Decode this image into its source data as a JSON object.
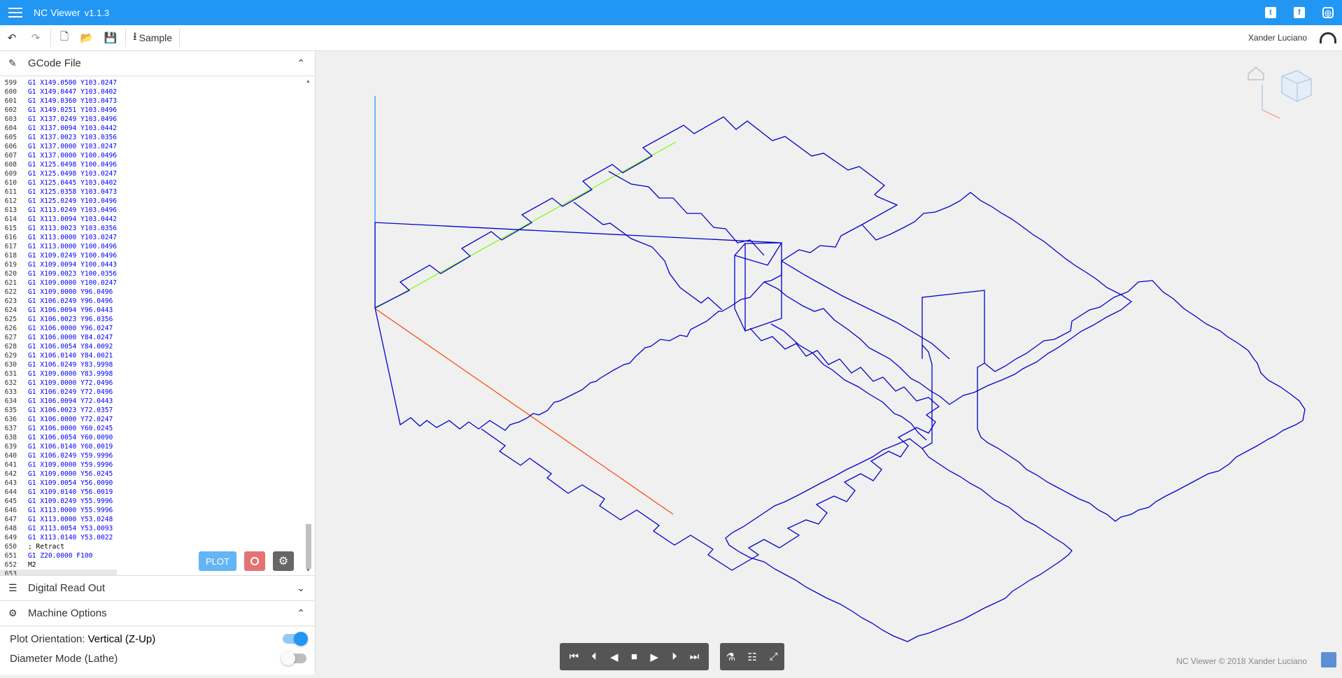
{
  "app": {
    "title": "NC Viewer",
    "version": "v1.1.3"
  },
  "social": {
    "twitter": "t",
    "facebook": "f",
    "instagram": "◎"
  },
  "toolbar": {
    "undo": "↶",
    "redo": "↷",
    "new_file": "🗋",
    "open": "📂",
    "save": "💾",
    "sample_label": "Sample",
    "sample_icon": "⭳",
    "user": "Xander Luciano"
  },
  "gcode_panel": {
    "title": "GCode File",
    "icon": "✎",
    "chevron": "⌃"
  },
  "code_lines": [
    [
      "599",
      "G1 X149.0500 Y103.0247"
    ],
    [
      "600",
      "G1 X149.0447 Y103.0402"
    ],
    [
      "601",
      "G1 X149.0360 Y103.0473"
    ],
    [
      "602",
      "G1 X149.0251 Y103.0496"
    ],
    [
      "603",
      "G1 X137.0249 Y103.0496"
    ],
    [
      "604",
      "G1 X137.0094 Y103.0442"
    ],
    [
      "605",
      "G1 X137.0023 Y103.0356"
    ],
    [
      "606",
      "G1 X137.0000 Y103.0247"
    ],
    [
      "607",
      "G1 X137.0000 Y100.0496"
    ],
    [
      "608",
      "G1 X125.0498 Y100.0496"
    ],
    [
      "609",
      "G1 X125.0498 Y103.0247"
    ],
    [
      "610",
      "G1 X125.0445 Y103.0402"
    ],
    [
      "611",
      "G1 X125.0358 Y103.0473"
    ],
    [
      "612",
      "G1 X125.0249 Y103.0496"
    ],
    [
      "613",
      "G1 X113.0249 Y103.0496"
    ],
    [
      "614",
      "G1 X113.0094 Y103.0442"
    ],
    [
      "615",
      "G1 X113.0023 Y103.0356"
    ],
    [
      "616",
      "G1 X113.0000 Y103.0247"
    ],
    [
      "617",
      "G1 X113.0000 Y100.0496"
    ],
    [
      "618",
      "G1 X109.0249 Y100.0496"
    ],
    [
      "619",
      "G1 X109.0094 Y100.0443"
    ],
    [
      "620",
      "G1 X109.0023 Y100.0356"
    ],
    [
      "621",
      "G1 X109.0000 Y100.0247"
    ],
    [
      "622",
      "G1 X109.0000 Y96.0496"
    ],
    [
      "623",
      "G1 X106.0249 Y96.0496"
    ],
    [
      "624",
      "G1 X106.0094 Y96.0443"
    ],
    [
      "625",
      "G1 X106.0023 Y96.0356"
    ],
    [
      "626",
      "G1 X106.0000 Y96.0247"
    ],
    [
      "627",
      "G1 X106.0000 Y84.0247"
    ],
    [
      "628",
      "G1 X106.0054 Y84.0092"
    ],
    [
      "629",
      "G1 X106.0140 Y84.0021"
    ],
    [
      "630",
      "G1 X106.0249 Y83.9998"
    ],
    [
      "631",
      "G1 X109.0000 Y83.9998"
    ],
    [
      "632",
      "G1 X109.0000 Y72.0496"
    ],
    [
      "633",
      "G1 X106.0249 Y72.0496"
    ],
    [
      "634",
      "G1 X106.0094 Y72.0443"
    ],
    [
      "635",
      "G1 X106.0023 Y72.0357"
    ],
    [
      "636",
      "G1 X106.0000 Y72.0247"
    ],
    [
      "637",
      "G1 X106.0000 Y60.0245"
    ],
    [
      "638",
      "G1 X106.0054 Y60.0090"
    ],
    [
      "639",
      "G1 X106.0140 Y60.0019"
    ],
    [
      "640",
      "G1 X106.0249 Y59.9996"
    ],
    [
      "641",
      "G1 X109.0000 Y59.9996"
    ],
    [
      "642",
      "G1 X109.0000 Y56.0245"
    ],
    [
      "643",
      "G1 X109.0054 Y56.0090"
    ],
    [
      "644",
      "G1 X109.0140 Y56.0019"
    ],
    [
      "645",
      "G1 X109.0249 Y55.9996"
    ],
    [
      "646",
      "G1 X113.0000 Y55.9996"
    ],
    [
      "647",
      "G1 X113.0000 Y53.0248"
    ],
    [
      "648",
      "G1 X113.0054 Y53.0093"
    ],
    [
      "649",
      "G1 X113.0140 Y53.0022"
    ],
    [
      "650",
      "; Retract"
    ],
    [
      "651",
      "G1 Z20.0000 F100"
    ],
    [
      "652",
      "M2"
    ],
    [
      "653",
      ""
    ]
  ],
  "editor_buttons": {
    "plot": "PLOT",
    "settings": "⚙"
  },
  "dro_panel": {
    "title": "Digital Read Out",
    "icon": "☰",
    "chevron": "⌄"
  },
  "machine_panel": {
    "title": "Machine Options",
    "icon": "⚙",
    "chevron": "⌃"
  },
  "options": {
    "plot_orientation_label": "Plot Orientation:",
    "plot_orientation_value": "Vertical (Z-Up)",
    "plot_orientation_on": true,
    "diameter_mode_label": "Diameter Mode (Lathe)",
    "diameter_mode_on": false
  },
  "player": {
    "first": "⏮",
    "prev": "⏴",
    "back": "◀",
    "stop": "■",
    "play": "▶",
    "next": "⏵",
    "last": "⏭",
    "flask": "⚗",
    "sliders": "☷",
    "expand": "⤢"
  },
  "footer": {
    "text": "NC Viewer © 2018 Xander Luciano"
  },
  "colors": {
    "toolpath": "#0000cc",
    "x_axis": "#ff4500",
    "y_axis": "#7cfc00",
    "z_axis": "#1e90ff",
    "accent": "#2196f3"
  }
}
